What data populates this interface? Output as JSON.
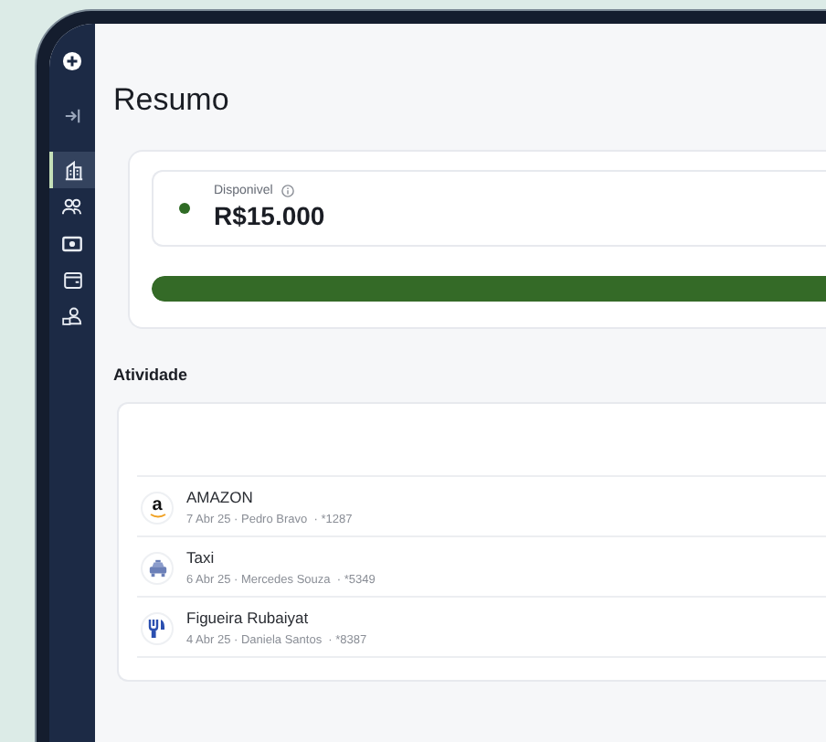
{
  "sidebar": {
    "items": [
      {
        "kind": "add",
        "selected": false
      },
      {
        "kind": "collapse",
        "selected": false
      },
      {
        "kind": "building",
        "selected": true
      },
      {
        "kind": "people",
        "selected": false
      },
      {
        "kind": "money",
        "selected": false
      },
      {
        "kind": "wallet",
        "selected": false
      },
      {
        "kind": "person-card",
        "selected": false
      }
    ]
  },
  "title": "Resumo",
  "summary": {
    "label": "Disponivel",
    "amount": "R$15.000",
    "level": 1
  },
  "activity": {
    "heading": "Atividade",
    "items": [
      {
        "kind": "amazon",
        "icon_text": "a",
        "name": "AMAZON",
        "details": "7 Abr 25 · Pedro Bravo  · *1287"
      },
      {
        "kind": "taxi",
        "name": "Taxi",
        "details": "6 Abr 25 · Mercedes Souza  · *5349"
      },
      {
        "kind": "restaurant",
        "name": "Figueira Rubaiyat",
        "details": "4 Abr 25 · Daniela Santos  · *8387"
      }
    ]
  }
}
